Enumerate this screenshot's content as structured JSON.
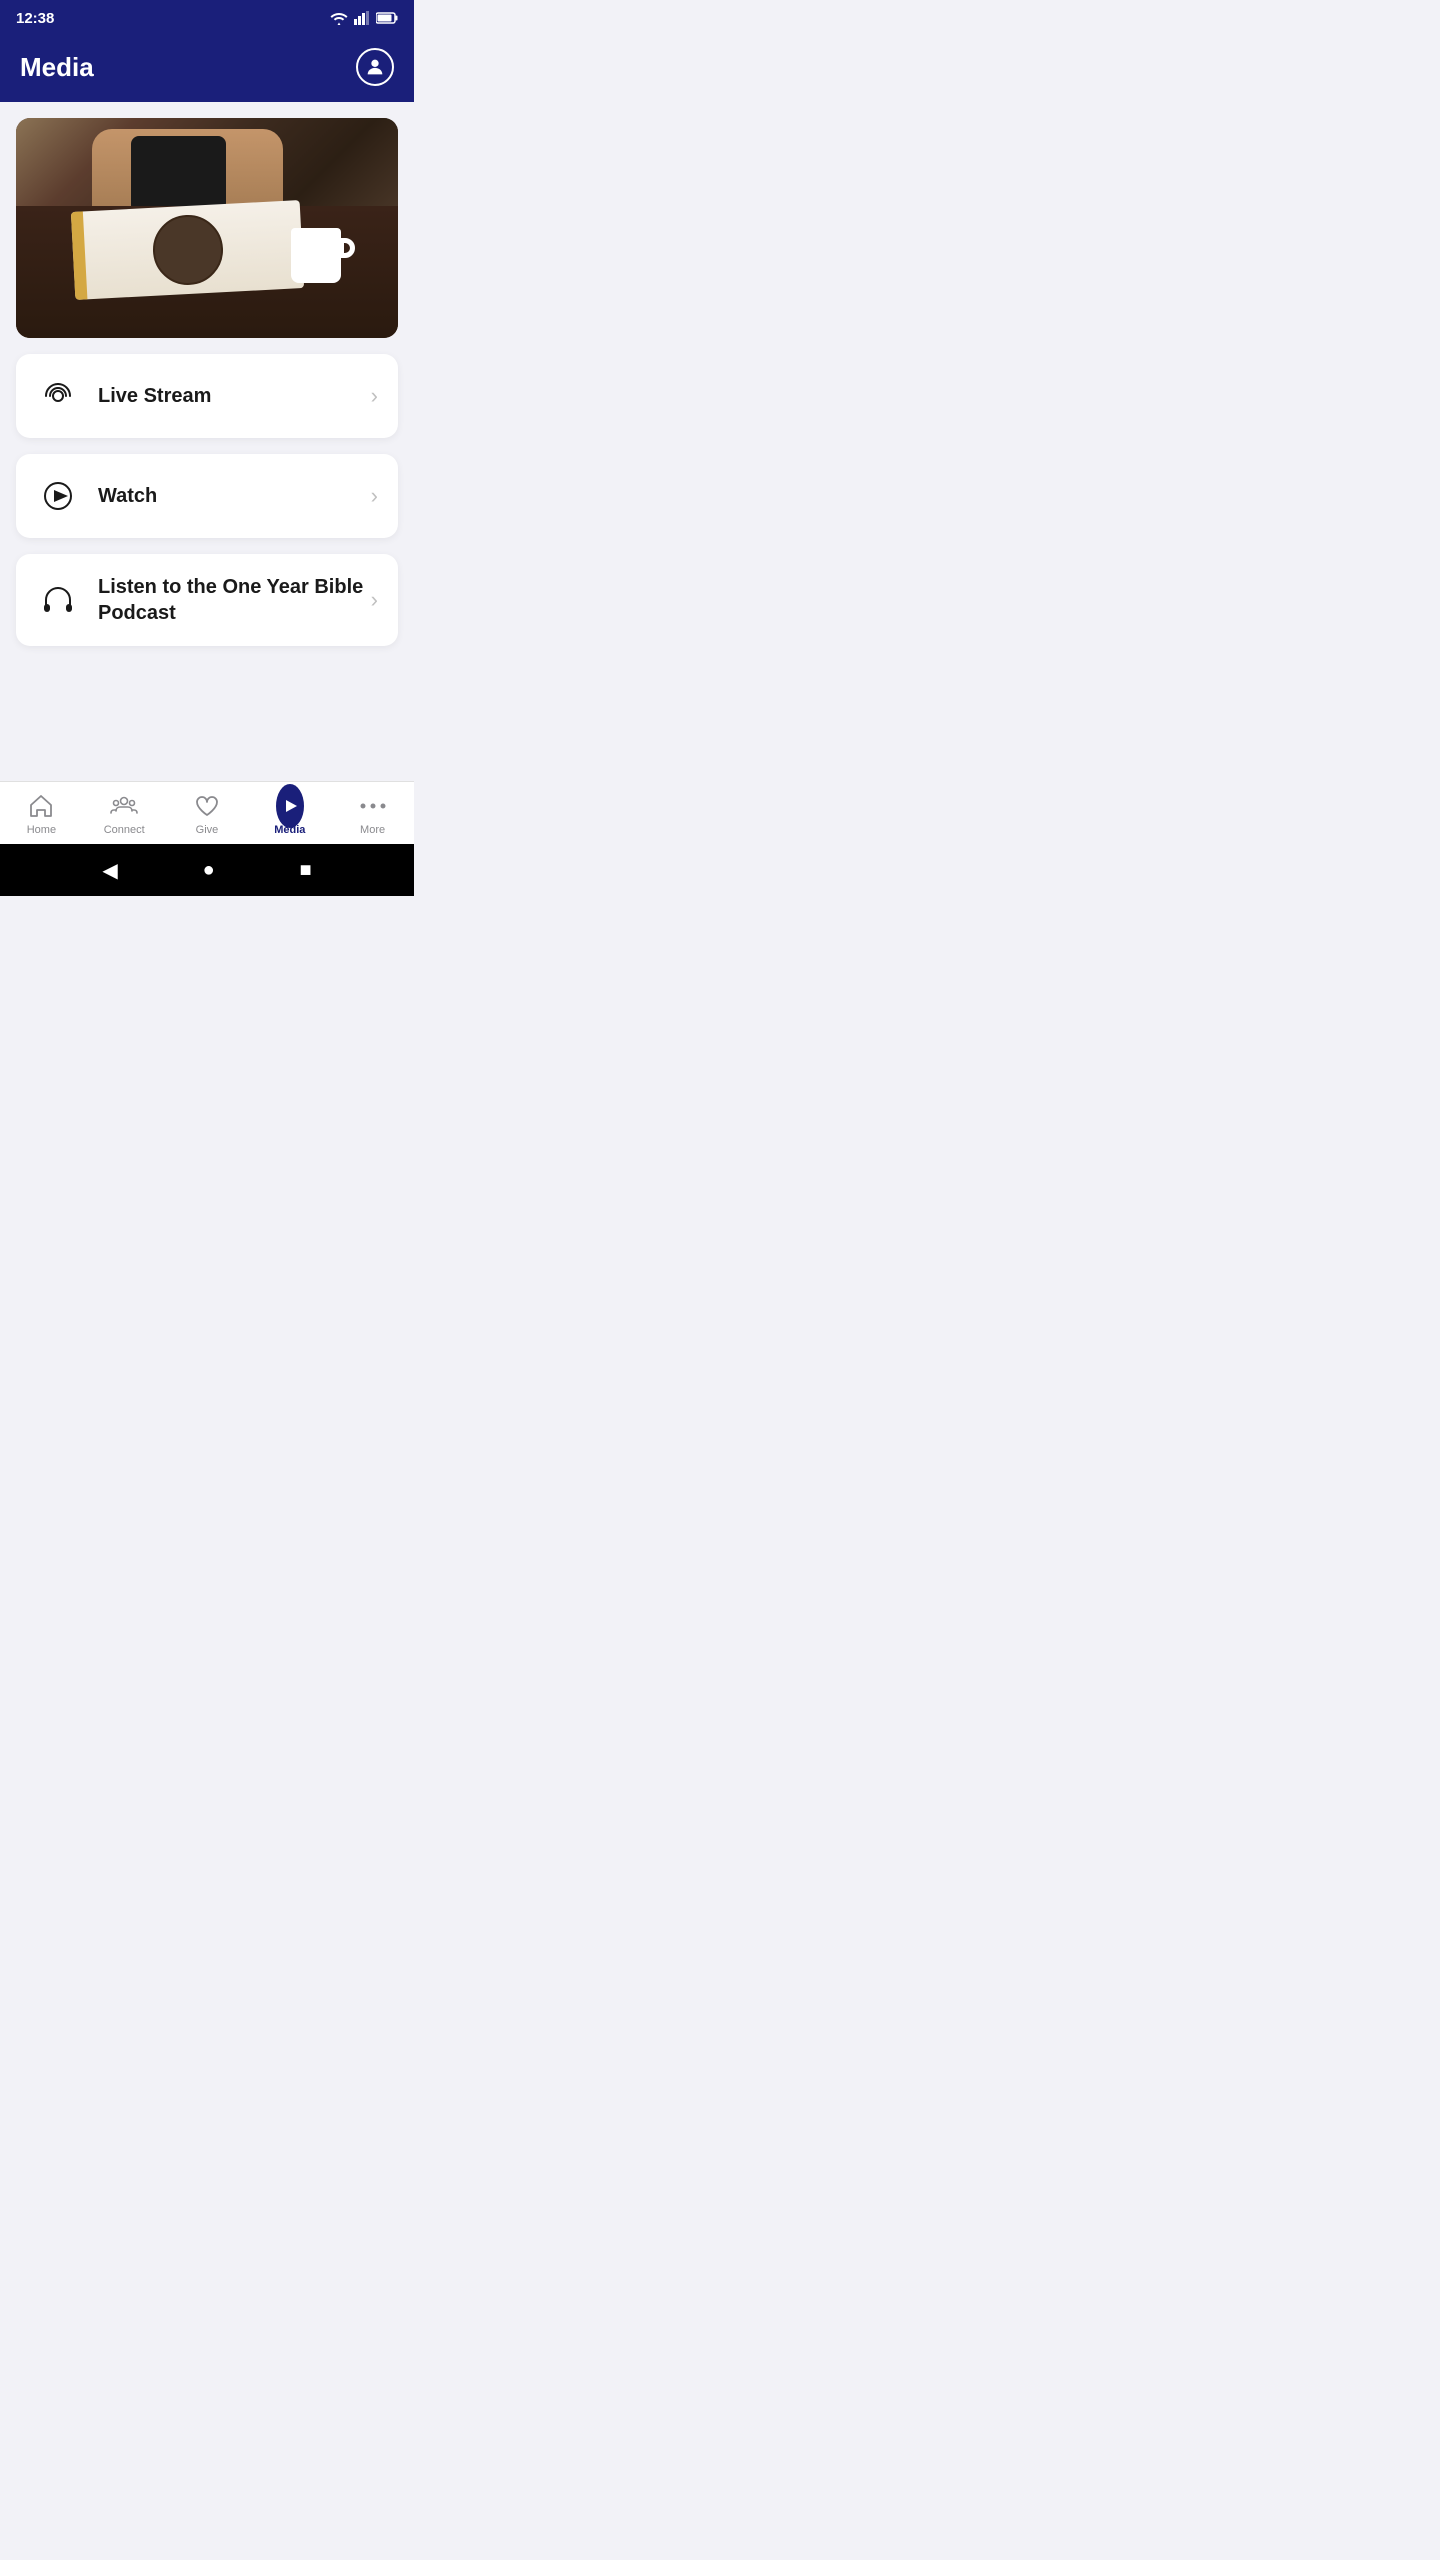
{
  "statusBar": {
    "time": "12:38"
  },
  "header": {
    "title": "Media",
    "avatarIcon": "user-icon"
  },
  "menuItems": [
    {
      "id": "live-stream",
      "label": "Live Stream",
      "iconType": "broadcast",
      "multiline": false
    },
    {
      "id": "watch",
      "label": "Watch",
      "iconType": "play",
      "multiline": false
    },
    {
      "id": "podcast",
      "label": "Listen to the One Year Bible Podcast",
      "iconType": "headphones",
      "multiline": true
    }
  ],
  "bottomNav": [
    {
      "id": "home",
      "label": "Home",
      "iconType": "home",
      "active": false
    },
    {
      "id": "connect",
      "label": "Connect",
      "iconType": "connect",
      "active": false
    },
    {
      "id": "give",
      "label": "Give",
      "iconType": "give",
      "active": false
    },
    {
      "id": "media",
      "label": "Media",
      "iconType": "media",
      "active": true
    },
    {
      "id": "more",
      "label": "More",
      "iconType": "more",
      "active": false
    }
  ]
}
